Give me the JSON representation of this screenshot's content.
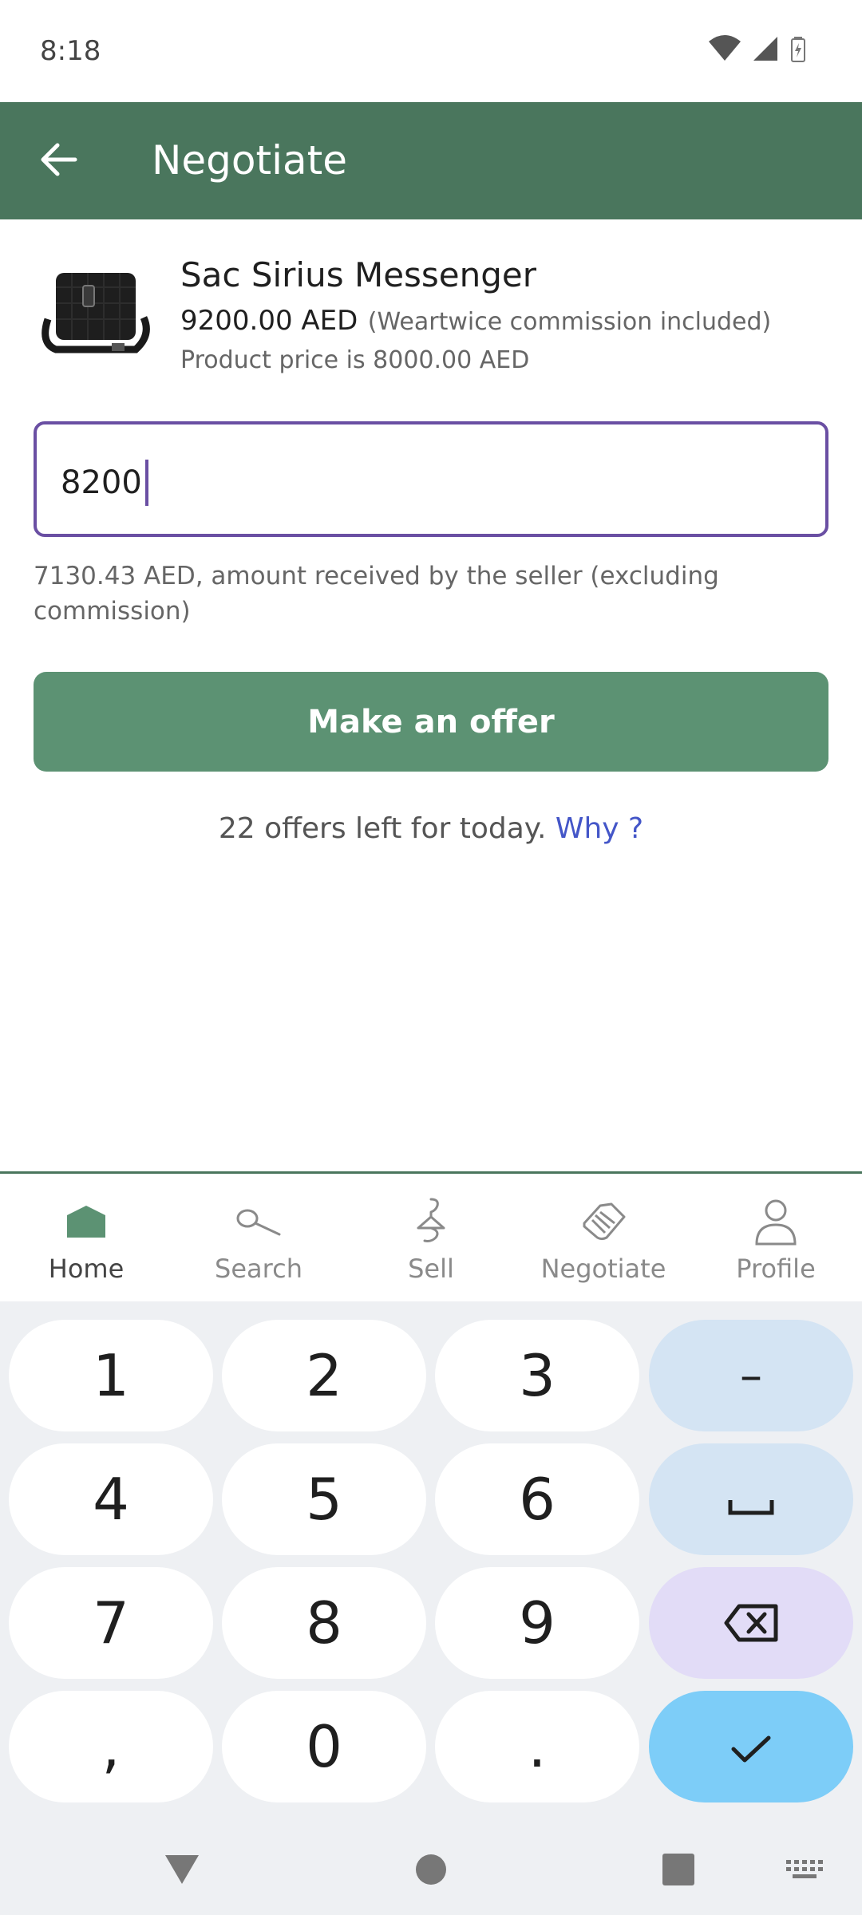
{
  "status_bar": {
    "time": "8:18"
  },
  "app_bar": {
    "title": "Negotiate"
  },
  "product": {
    "name": "Sac Sirius Messenger",
    "price": "9200.00 AED",
    "commission_note": "(Weartwice commission included)",
    "product_price": "Product price is 8000.00 AED"
  },
  "offer": {
    "input_value": "8200",
    "helper_text": "7130.43 AED, amount received by the seller (excluding commission)",
    "button_label": "Make an offer",
    "offers_left_text": "22 offers left for today.",
    "why_link": "Why ?"
  },
  "bottom_nav": {
    "items": [
      {
        "label": "Home",
        "icon": "home-icon",
        "active": true
      },
      {
        "label": "Search",
        "icon": "search-icon"
      },
      {
        "label": "Sell",
        "icon": "hanger-icon"
      },
      {
        "label": "Negotiate",
        "icon": "handshake-icon"
      },
      {
        "label": "Profile",
        "icon": "person-icon"
      }
    ]
  },
  "keyboard": {
    "keys": [
      "1",
      "2",
      "3",
      "–",
      "4",
      "5",
      "6",
      "␣",
      "7",
      "8",
      "9",
      "⌫",
      ",",
      "0",
      ".",
      "✓"
    ]
  },
  "colors": {
    "brand_green": "#4a765d",
    "button_green": "#5c9273",
    "input_border": "#6a4fa3",
    "link_blue": "#4456c8"
  }
}
